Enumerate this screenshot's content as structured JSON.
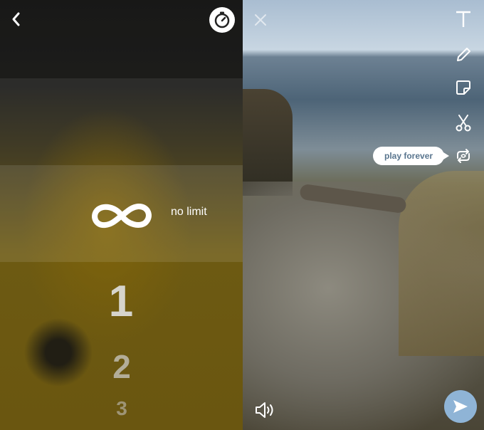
{
  "timer_picker": {
    "selected_label": "no limit",
    "options": [
      "1",
      "2",
      "3"
    ]
  },
  "right_toolbar": {
    "loop_tooltip": "play forever"
  },
  "icons": {
    "back": "chevron-left-icon",
    "timer": "stopwatch-icon",
    "infinity": "infinity-icon",
    "close": "close-icon",
    "text": "text-tool-icon",
    "pencil": "pencil-icon",
    "sticker": "sticker-icon",
    "scissors": "scissors-icon",
    "loop": "loop-icon",
    "volume": "volume-icon",
    "send": "send-arrow-icon"
  },
  "colors": {
    "tooltip_text": "#59758e",
    "send_button": "#8fb4d6"
  }
}
